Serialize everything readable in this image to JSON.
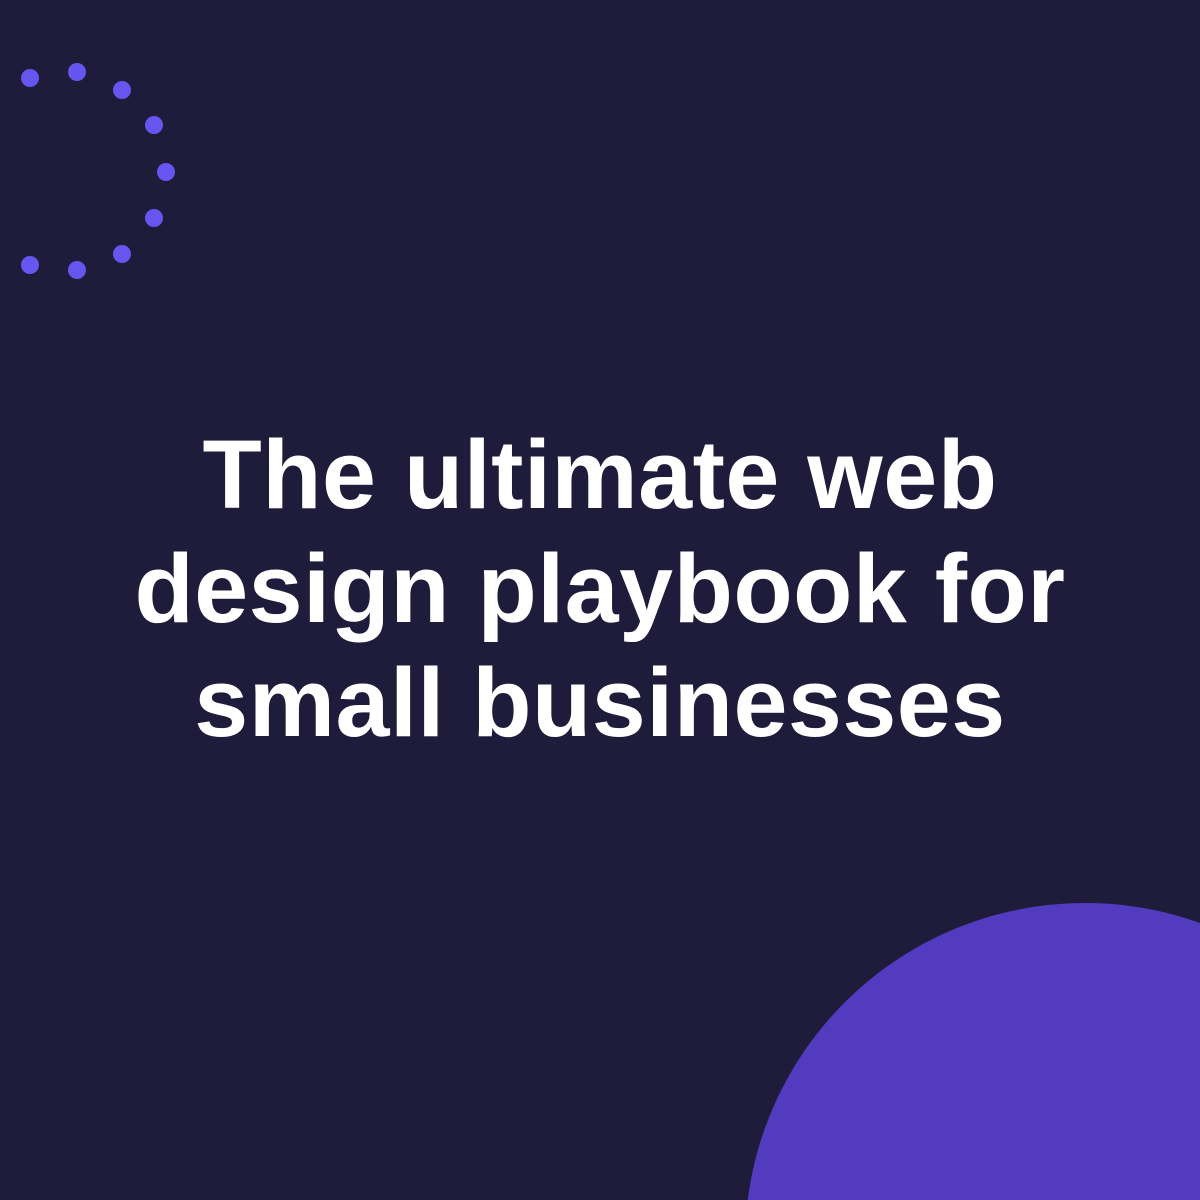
{
  "headline": {
    "lines": [
      "The ultimate web",
      "design playbook for",
      "small businesses"
    ]
  },
  "colors": {
    "background": "#1e1c3a",
    "dots": "#6655ee",
    "circle": "#523bbf",
    "text": "#ffffff"
  },
  "decorations": [
    "dotted-arc",
    "corner-circle"
  ]
}
